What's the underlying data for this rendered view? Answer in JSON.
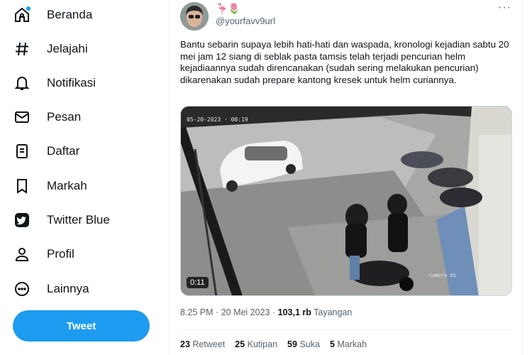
{
  "sidebar": {
    "items": [
      {
        "label": "Beranda",
        "icon": "home-icon"
      },
      {
        "label": "Jelajahi",
        "icon": "hashtag-icon"
      },
      {
        "label": "Notifikasi",
        "icon": "bell-icon"
      },
      {
        "label": "Pesan",
        "icon": "mail-icon"
      },
      {
        "label": "Daftar",
        "icon": "list-icon"
      },
      {
        "label": "Markah",
        "icon": "bookmark-icon"
      },
      {
        "label": "Twitter Blue",
        "icon": "twitter-blue-icon"
      },
      {
        "label": "Profil",
        "icon": "profile-icon"
      },
      {
        "label": "Lainnya",
        "icon": "more-circle-icon"
      }
    ],
    "tweet_button": "Tweet"
  },
  "tweet": {
    "display_name": "🦩🌷",
    "handle": "@yourfavv9url",
    "more": "···",
    "text": "Bantu sebarin supaya lebih hati-hati dan waspada, kronologi kejadian sabtu 20 mei jam 12 siang di seblak pasta tamsis telah terjadi pencurian helm kejadiaannya sudah direncanakan (sudah sering melakukan pencurian) dikarenakan sudah prepare kantong kresek untuk helm curiannya.",
    "media": {
      "cctv_timestamp": "05-20-2023  ·  00:19",
      "cctv_camera": "Camera 01",
      "duration": "0:11"
    },
    "time": "8.25 PM",
    "date": "20 Mei 2023",
    "views_count": "103,1 rb",
    "views_label": "Tayangan",
    "stats": [
      {
        "count": "23",
        "label": "Retweet"
      },
      {
        "count": "25",
        "label": "Kutipan"
      },
      {
        "count": "59",
        "label": "Suka"
      },
      {
        "count": "5",
        "label": "Markah"
      }
    ]
  },
  "colors": {
    "accent": "#1d9bf0",
    "text": "#0f1419",
    "secondary": "#536471"
  }
}
